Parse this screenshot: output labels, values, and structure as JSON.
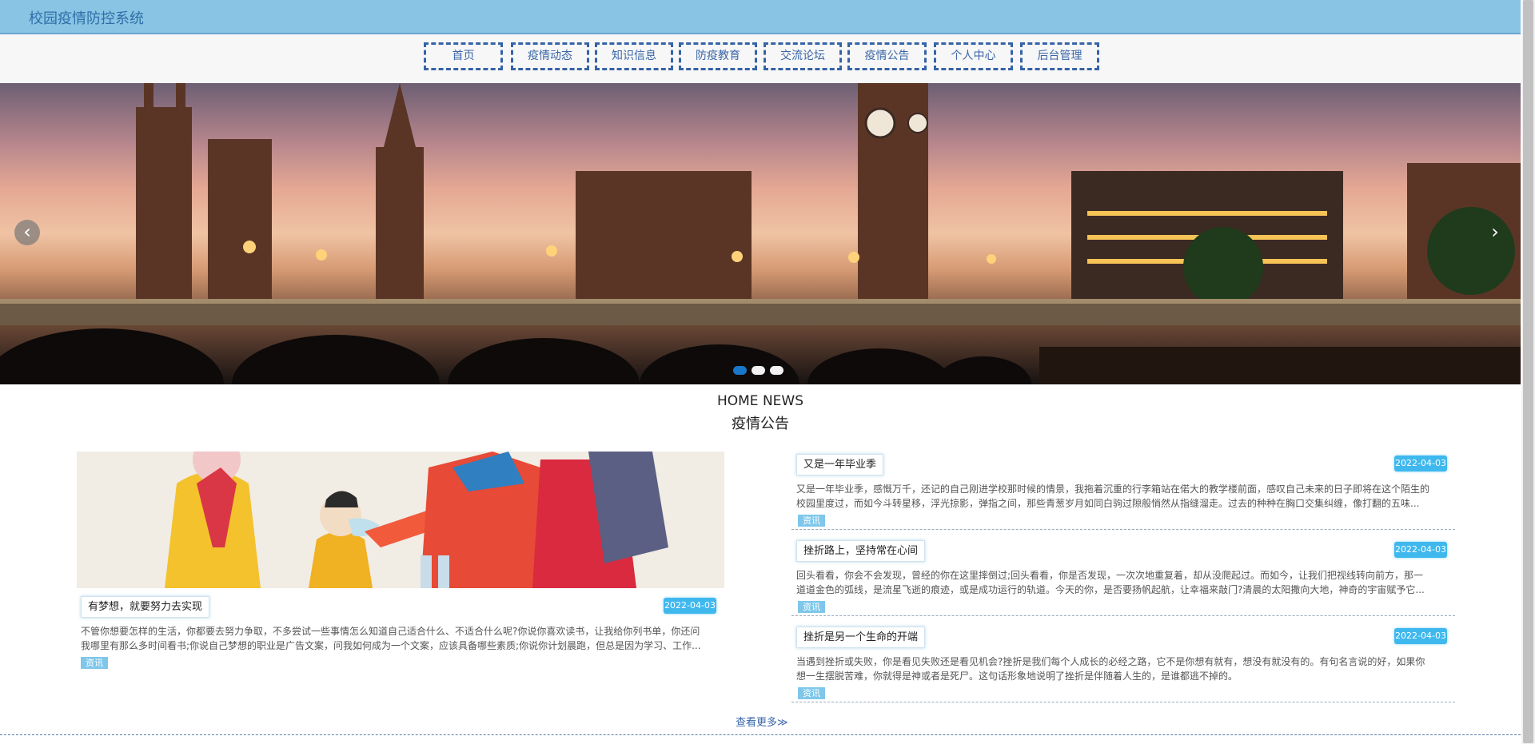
{
  "header": {
    "title": "校园疫情防控系统"
  },
  "nav": [
    {
      "label": "首页"
    },
    {
      "label": "疫情动态"
    },
    {
      "label": "知识信息"
    },
    {
      "label": "防疫教育"
    },
    {
      "label": "交流论坛"
    },
    {
      "label": "疫情公告"
    },
    {
      "label": "个人中心"
    },
    {
      "label": "后台管理"
    }
  ],
  "carousel": {
    "prev": "‹",
    "next": "›",
    "slides": 3,
    "active_slide": 1
  },
  "section": {
    "title_en": "HOME NEWS",
    "title_cn": "疫情公告"
  },
  "featured": {
    "title": "有梦想，就要努力去实现",
    "date": "2022-04-03",
    "excerpt_1": "不管你想要怎样的生活，你都要去努力争取，不多尝试一些事情怎么知道自己适合什么、不适合什么呢?你说你喜欢读书，让我给你列书单，你还问",
    "excerpt_2": "我哪里有那么多时间看书;你说自己梦想的职业是广告文案，问我如何成为一个文案，应该具备哪些素质;你说你计划晨跑，但总是因为学习、工作...",
    "tag": "资讯"
  },
  "news": [
    {
      "title": "又是一年毕业季",
      "date": "2022-04-03",
      "excerpt_1": "又是一年毕业季，感慨万千，还记的自己刚进学校那时候的情景，我拖着沉重的行李箱站在偌大的教学楼前面，感叹自己未来的日子即将在这个陌生的",
      "excerpt_2": "校园里度过，而如今斗转星移，浮光掠影，弹指之间，那些青葱岁月如同白驹过隙般悄然从指缝溜走。过去的种种在胸口交集纠缠，像打翻的五味...",
      "tag": "资讯"
    },
    {
      "title": "挫折路上，坚持常在心间",
      "date": "2022-04-03",
      "excerpt_1": "回头看看，你会不会发现，曾经的你在这里摔倒过;回头看看，你是否发现，一次次地重复着，却从没爬起过。而如今，让我们把视线转向前方，那一",
      "excerpt_2": "道道金色的弧线，是流星飞逝的痕迹，或是成功运行的轨道。今天的你，是否要扬帆起航，让幸福来敲门?清晨的太阳撒向大地，神奇的宇宙赋予它...",
      "tag": "资讯"
    },
    {
      "title": "挫折是另一个生命的开端",
      "date": "2022-04-03",
      "excerpt_1": "当遇到挫折或失败，你是看见失败还是看见机会?挫折是我们每个人成长的必经之路，它不是你想有就有，想没有就没有的。有句名言说的好，如果你",
      "excerpt_2": "想一生摆脱苦难，你就得是神或者是死尸。这句话形象地说明了挫折是伴随着人生的，是谁都逃不掉的。",
      "tag": "资讯"
    }
  ],
  "more_link": "查看更多≫",
  "colors": {
    "header": "#89c4e4",
    "nav_border": "#3563a7",
    "date_badge": "#3fb8ee",
    "tag": "#7fc7ea"
  }
}
